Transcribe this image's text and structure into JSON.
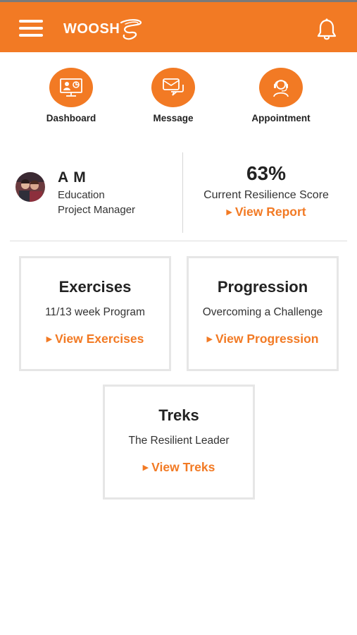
{
  "header": {
    "logo_text": "WOOSH",
    "menu_icon": "hamburger-menu-icon",
    "bell_icon": "bell-icon",
    "background_color": "#f27a24"
  },
  "quick_actions": [
    {
      "label": "Dashboard",
      "icon": "dashboard-icon"
    },
    {
      "label": "Message",
      "icon": "message-icon"
    },
    {
      "label": "Appointment",
      "icon": "appointment-icon"
    }
  ],
  "profile": {
    "name": "A M",
    "department": "Education",
    "role": "Project Manager"
  },
  "resilience": {
    "score": "63%",
    "label": "Current Resilience Score",
    "link": "View Report"
  },
  "cards": {
    "exercises": {
      "title": "Exercises",
      "subtitle": "11/13 week Program",
      "link": "View Exercises"
    },
    "progression": {
      "title": "Progression",
      "subtitle": "Overcoming a Challenge",
      "link": "View Progression"
    },
    "treks": {
      "title": "Treks",
      "subtitle": "The Resilient Leader",
      "link": "View Treks"
    }
  },
  "colors": {
    "accent": "#f27a24",
    "card_border": "#e6e6e6"
  }
}
